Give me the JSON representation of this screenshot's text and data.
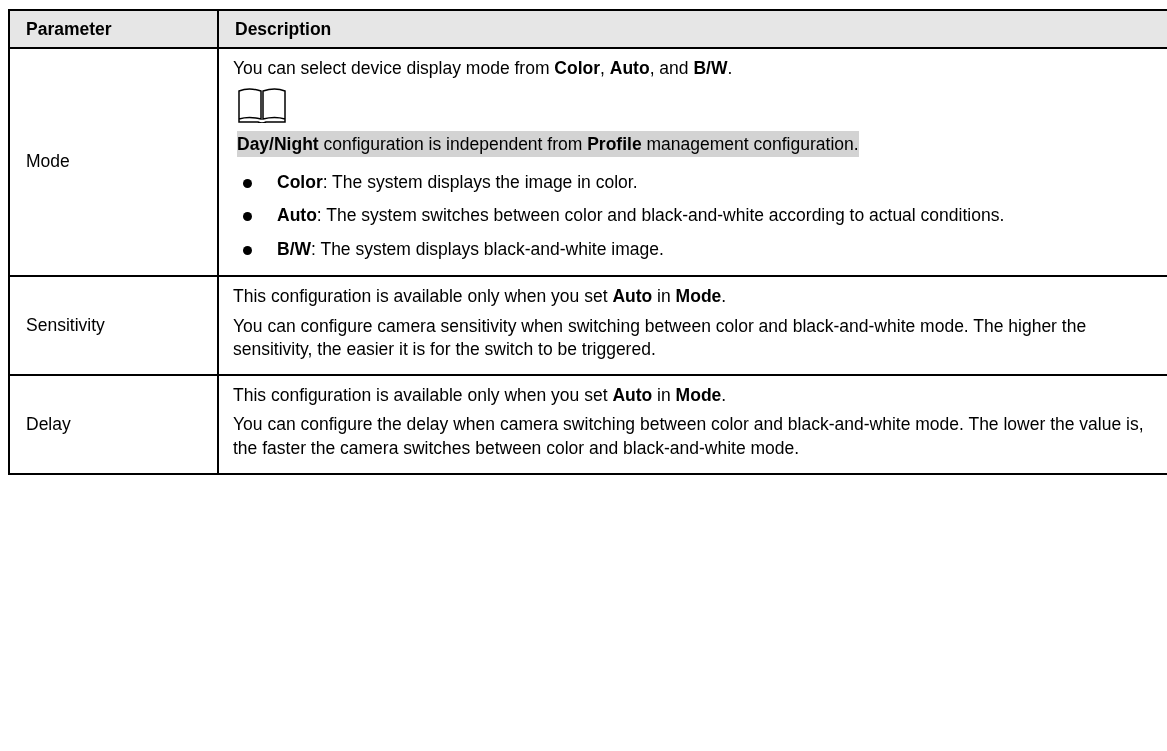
{
  "table": {
    "columns": [
      "Parameter",
      "Description"
    ],
    "rows": [
      {
        "parameter": "Mode",
        "content": [
          {
            "kind": "text",
            "text": "You can select device display mode from **Color**, **Auto**, and **B/W**."
          },
          {
            "kind": "note_icon"
          },
          {
            "kind": "note",
            "text": "**Day/Night** configuration is independent from **Profile** management configuration."
          },
          {
            "kind": "bullet",
            "text": "**Color**: The system displays the image in color."
          },
          {
            "kind": "bullet",
            "text": "**Auto**: The system switches between color and black-and-white according to actual conditions."
          },
          {
            "kind": "bullet",
            "text": "**B/W**: The system displays black-and-white image."
          }
        ]
      },
      {
        "parameter": "Sensitivity",
        "content": [
          {
            "kind": "text",
            "text": "This configuration is available only when you set **Auto** in **Mode**."
          },
          {
            "kind": "text",
            "text": "You can configure camera sensitivity when switching between color and black-and-white mode. The higher the sensitivity, the easier it is for the switch to be triggered."
          }
        ]
      },
      {
        "parameter": "Delay",
        "content": [
          {
            "kind": "text",
            "text": "This configuration is available only when you set **Auto** in **Mode**."
          },
          {
            "kind": "text",
            "text": "You can configure the delay when camera switching between color and black-and-white mode. The lower the value is, the faster the camera switches between color and black-and-white mode."
          }
        ]
      }
    ]
  }
}
